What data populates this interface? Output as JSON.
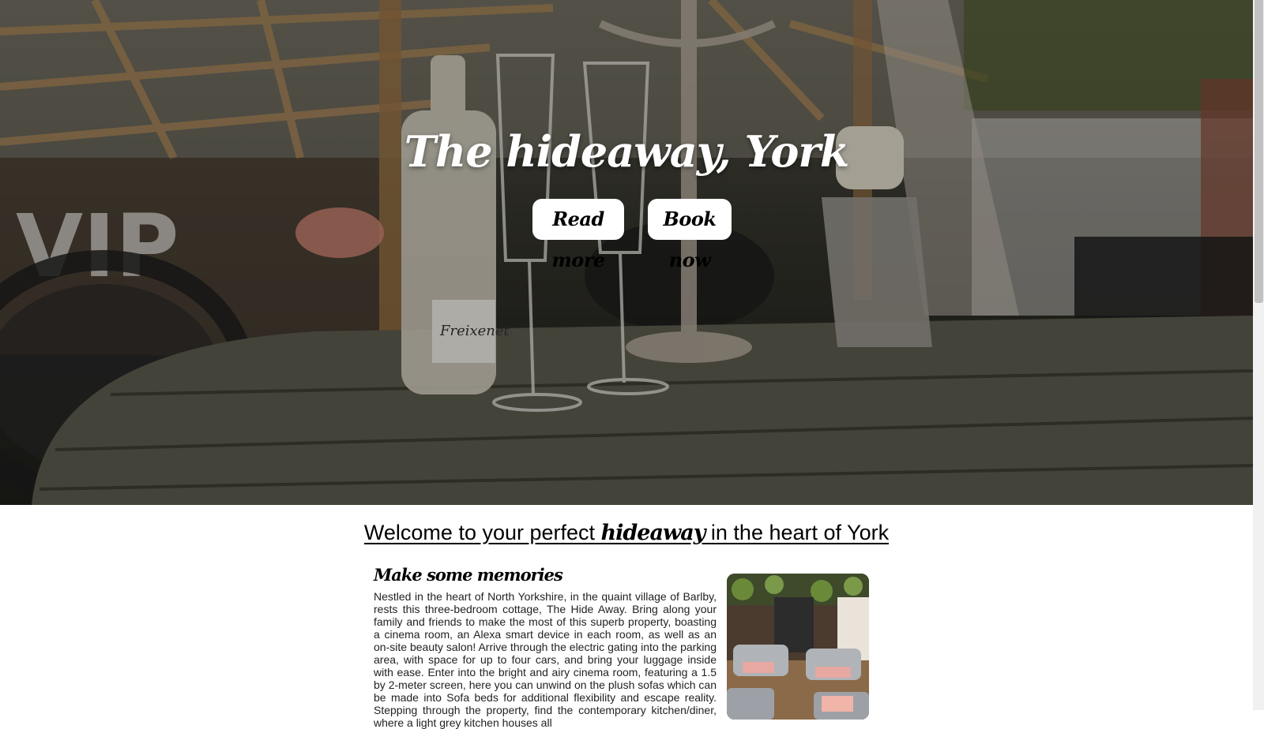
{
  "hero": {
    "title": "The hideaway, York",
    "read_more_label": "Read more",
    "book_now_label": "Book now"
  },
  "welcome": {
    "prefix": "Welcome to your perfect ",
    "emphasis": "hideaway",
    "suffix": " in the heart of York"
  },
  "section": {
    "heading": "Make some memories",
    "body": "Nestled in the heart of North Yorkshire, in the quaint village of Barlby, rests this three-bedroom cottage, The Hide Away. Bring along your family and friends to make the most of this superb property, boasting a cinema room, an Alexa smart device in each room, as well as an on-site beauty salon! Arrive through the electric gating into the parking area, with space for up to four cars, and bring your luggage inside with ease. Enter into the bright and airy cinema room, featuring a 1.5 by 2-meter screen, here you can unwind on the plush sofas which can be made into Sofa beds for additional flexibility and escape reality. Stepping through the property, find the contemporary kitchen/diner, where a light grey kitchen houses all"
  },
  "colors": {
    "button_bg": "#ffffff",
    "title_color": "#ffffff",
    "text_color": "#000000"
  }
}
